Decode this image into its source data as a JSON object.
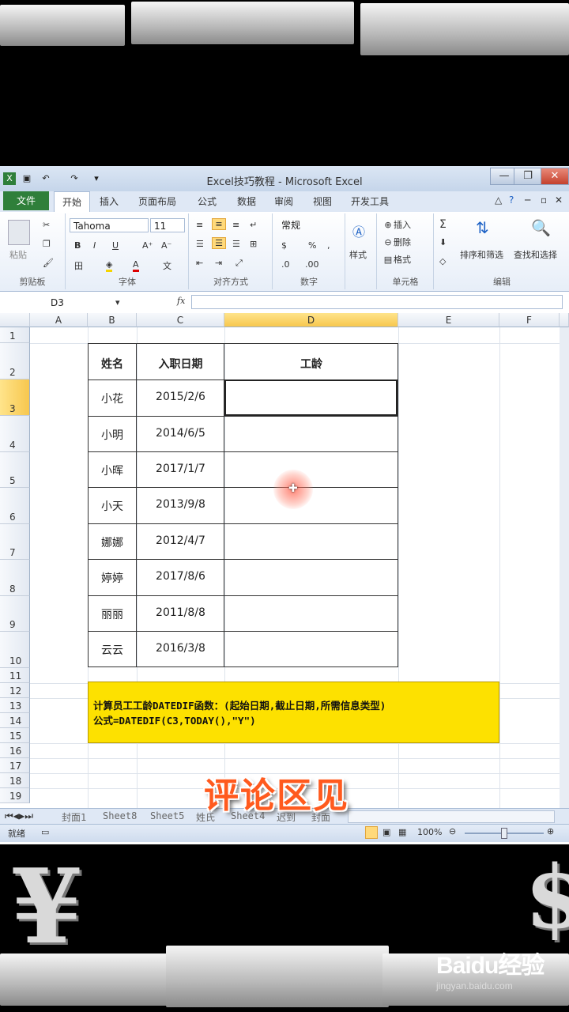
{
  "window": {
    "title": "Excel技巧教程 - Microsoft Excel",
    "buttons": {
      "minimize": "—",
      "restore": "❐",
      "close": "✕"
    }
  },
  "ribbon_tabs": [
    "文件",
    "开始",
    "插入",
    "页面布局",
    "公式",
    "数据",
    "审阅",
    "视图",
    "开发工具"
  ],
  "ribbon": {
    "clipboard": {
      "label": "剪贴板",
      "paste": "粘贴"
    },
    "font": {
      "label": "字体",
      "name": "Tahoma",
      "size": "11",
      "bold": "B",
      "italic": "I",
      "underline": "U"
    },
    "alignment": {
      "label": "对齐方式"
    },
    "number": {
      "label": "数字",
      "format": "常规",
      "percent": "%"
    },
    "styles": {
      "label": "样式"
    },
    "cells": {
      "label": "单元格",
      "insert": "插入",
      "delete": "删除",
      "format": "格式"
    },
    "editing": {
      "label": "编辑",
      "sort": "排序和筛选",
      "find": "查找和选择"
    }
  },
  "formula_bar": {
    "name_box": "D3",
    "fx": "fx",
    "value": ""
  },
  "columns": [
    "A",
    "B",
    "C",
    "D",
    "E",
    "F"
  ],
  "rows": [
    "1",
    "2",
    "3",
    "4",
    "5",
    "6",
    "7",
    "8",
    "9",
    "10",
    "11",
    "12",
    "13",
    "14",
    "15",
    "16",
    "17",
    "18",
    "19"
  ],
  "table": {
    "headers": [
      "姓名",
      "入职日期",
      "工龄"
    ],
    "rows": [
      [
        "小花",
        "2015/2/6",
        ""
      ],
      [
        "小明",
        "2014/6/5",
        ""
      ],
      [
        "小晖",
        "2017/1/7",
        ""
      ],
      [
        "小天",
        "2013/9/8",
        ""
      ],
      [
        "娜娜",
        "2012/4/7",
        ""
      ],
      [
        "婷婷",
        "2017/8/6",
        ""
      ],
      [
        "丽丽",
        "2011/8/8",
        ""
      ],
      [
        "云云",
        "2016/3/8",
        ""
      ]
    ]
  },
  "note": {
    "line1": "计算员工工龄DATEDIF函数：(起始日期,截止日期,所需信息类型)",
    "line2": "公式=DATEDIF(C3,TODAY(),\"Y\")"
  },
  "overlay_text": "评论区见",
  "sheet_tabs": [
    "封面1",
    "Sheet8",
    "Sheet5",
    "姓氏",
    "Sheet4",
    "迟到",
    "封面"
  ],
  "status": {
    "mode": "就绪",
    "zoom": "100%"
  },
  "watermark": {
    "brand": "Baidu经验",
    "url": "jingyan.baidu.com"
  },
  "decor": {
    "left_symbol": "¥",
    "right_symbol": "$"
  }
}
